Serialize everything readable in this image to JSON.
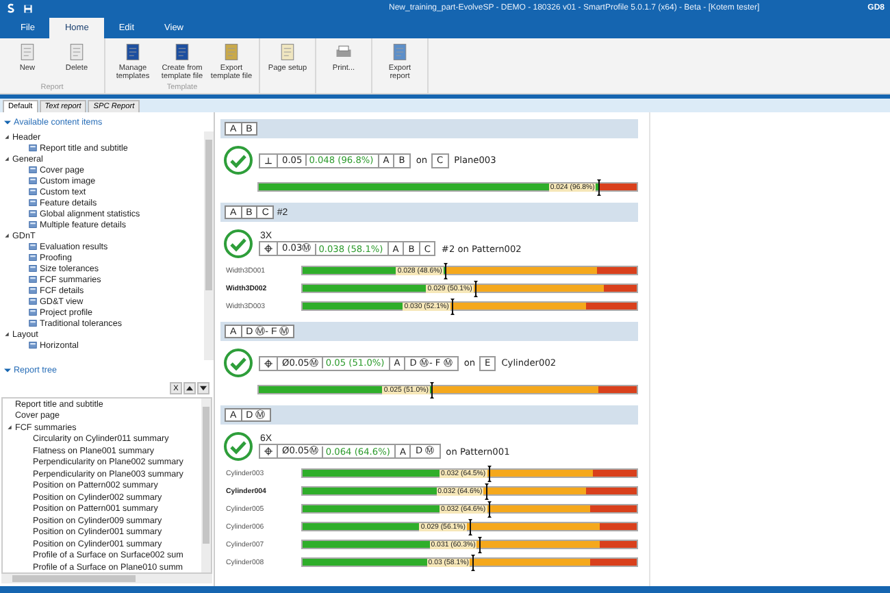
{
  "window": {
    "title": "New_training_part-EvolveSP - DEMO - 180326 v01 - SmartProfile 5.0.1.7 (x64) - Beta - [Kotem tester]",
    "title_right": "GD8"
  },
  "menu_tabs": [
    {
      "label": "File",
      "selected": false
    },
    {
      "label": "Home",
      "selected": true
    },
    {
      "label": "Edit",
      "selected": false
    },
    {
      "label": "View",
      "selected": false
    }
  ],
  "ribbon_groups": [
    {
      "label": "Report",
      "buttons": [
        {
          "kind": "new",
          "label": "New"
        },
        {
          "kind": "delete",
          "label": "Delete"
        }
      ]
    },
    {
      "label": "Template",
      "buttons": [
        {
          "kind": "manage",
          "label": "Manage templates"
        },
        {
          "kind": "create",
          "label": "Create from template file"
        },
        {
          "kind": "export-template",
          "label": "Export template file"
        }
      ]
    },
    {
      "buttons": [
        {
          "kind": "page",
          "label": "Page setup"
        }
      ]
    },
    {
      "buttons": [
        {
          "kind": "print",
          "label": "Print..."
        }
      ]
    },
    {
      "buttons": [
        {
          "kind": "export",
          "label": "Export report"
        }
      ]
    }
  ],
  "doc_tabs": [
    {
      "label": "Default",
      "selected": true
    },
    {
      "label": "Text report",
      "selected": false
    },
    {
      "label": "SPC Report",
      "selected": false
    }
  ],
  "content_panel": {
    "title": "Available content items",
    "expanded": true,
    "items": [
      {
        "label": "Header",
        "expanded": true,
        "children": [
          {
            "label": "Report title and subtitle"
          }
        ]
      },
      {
        "label": "General",
        "expanded": true,
        "children": [
          {
            "label": "Cover page"
          },
          {
            "label": "Custom image"
          },
          {
            "label": "Custom text"
          },
          {
            "label": "Feature details"
          },
          {
            "label": "Global alignment statistics"
          },
          {
            "label": "Multiple feature details"
          }
        ]
      },
      {
        "label": "GDnT",
        "expanded": true,
        "children": [
          {
            "label": "Evaluation results"
          },
          {
            "label": "Proofing"
          },
          {
            "label": "Size tolerances"
          },
          {
            "label": "FCF summaries"
          },
          {
            "label": "FCF details"
          },
          {
            "label": "GD&T view"
          },
          {
            "label": "Project profile"
          },
          {
            "label": "Traditional tolerances"
          }
        ]
      },
      {
        "label": "Layout",
        "expanded": true,
        "children": [
          {
            "label": "Horizontal"
          }
        ]
      }
    ]
  },
  "report_tree": {
    "title": "Report tree",
    "expanded": true,
    "remove_button": "X",
    "items": [
      {
        "label": "Report title and subtitle"
      },
      {
        "label": "Cover page"
      },
      {
        "label": "FCF summaries",
        "expanded": true,
        "children": [
          {
            "label": "Circularity on Cylinder011 summary"
          },
          {
            "label": "Flatness on Plane001 summary"
          },
          {
            "label": "Perpendicularity on Plane002 summary"
          },
          {
            "label": "Perpendicularity on Plane003 summary"
          },
          {
            "label": "Position on Pattern002 summary"
          },
          {
            "label": "Position on Cylinder002 summary"
          },
          {
            "label": "Position on Pattern001 summary"
          },
          {
            "label": "Position on Cylinder009 summary"
          },
          {
            "label": "Position on Cylinder001 summary"
          },
          {
            "label": "Position on Cylinder001 summary"
          },
          {
            "label": "Profile of a Surface on Surface002 sum"
          },
          {
            "label": "Profile of a Surface on Plane010 summ"
          }
        ]
      }
    ]
  },
  "sections": [
    {
      "header": {
        "cells": [
          "A",
          "B"
        ]
      },
      "passed": true,
      "fcf": {
        "kind": "perpendicularity",
        "tolerance": "0.05",
        "actual": "0.048 (96.8%)",
        "datums": [
          "A",
          "B"
        ]
      },
      "suffix": [
        {
          "kind": "text",
          "text": "on"
        },
        {
          "kind": "box",
          "text": "C"
        },
        {
          "kind": "text",
          "text": "Plane003"
        }
      ],
      "bars": [
        {
          "reading": "0.024 (96.8%)",
          "level": 0.9,
          "fills": [
            {
              "kind": "pass",
              "level": 0.9
            }
          ]
        }
      ]
    },
    {
      "header": {
        "cells": [
          "A",
          "B",
          "C"
        ],
        "note": "#2"
      },
      "passed": true,
      "count": "3X",
      "fcf": {
        "kind": "position",
        "tolerance": "0.03Ⓜ",
        "actual": "0.038 (58.1%)",
        "datums": [
          "A",
          "B",
          "C"
        ]
      },
      "suffix": [
        {
          "kind": "text",
          "text": "#2 on Pattern002"
        }
      ],
      "bars": [
        {
          "label": "Width3D001",
          "selected": false,
          "reading": "0.028 (48.6%)",
          "level": 0.43,
          "fills": [
            {
              "kind": "warn",
              "level": 0.88
            },
            {
              "kind": "pass",
              "level": 0.43
            }
          ]
        },
        {
          "label": "Width3D002",
          "selected": true,
          "reading": "0.029 (50.1%)",
          "level": 0.52,
          "fills": [
            {
              "kind": "warn",
              "level": 0.9
            },
            {
              "kind": "pass",
              "level": 0.42
            }
          ]
        },
        {
          "label": "Width3D003",
          "selected": false,
          "reading": "0.030 (52.1%)",
          "level": 0.45,
          "fills": [
            {
              "kind": "warn",
              "level": 0.85
            },
            {
              "kind": "pass",
              "level": 0.43
            }
          ]
        }
      ]
    },
    {
      "header": {
        "cells": [
          "A",
          "D Ⓜ- F Ⓜ"
        ]
      },
      "passed": true,
      "fcf": {
        "kind": "position",
        "tolerance": "Ø0.05Ⓜ",
        "actual": "0.05 (51.0%)",
        "datums": [
          "A",
          "D Ⓜ- F Ⓜ"
        ]
      },
      "suffix": [
        {
          "kind": "text",
          "text": "on"
        },
        {
          "kind": "box",
          "text": "E"
        },
        {
          "kind": "text",
          "text": "Cylinder002"
        }
      ],
      "bars": [
        {
          "reading": "0.025 (51.0%)",
          "level": 0.46,
          "fills": [
            {
              "kind": "warn",
              "level": 0.9
            },
            {
              "kind": "pass",
              "level": 0.46
            }
          ]
        }
      ]
    },
    {
      "header": {
        "cells": [
          "A",
          "D Ⓜ"
        ]
      },
      "passed": true,
      "count": "6X",
      "fcf": {
        "kind": "position",
        "tolerance": "Ø0.05Ⓜ",
        "actual": "0.064 (64.6%)",
        "datums": [
          "A",
          "D Ⓜ"
        ]
      },
      "suffix": [
        {
          "kind": "text",
          "text": "on Pattern001"
        }
      ],
      "bars": [
        {
          "label": "Cylinder003",
          "selected": false,
          "reading": "0.032 (64.5%)",
          "level": 0.56,
          "fills": [
            {
              "kind": "warn",
              "level": 0.87
            },
            {
              "kind": "pass",
              "level": 0.43
            }
          ]
        },
        {
          "label": "Cylinder004",
          "selected": true,
          "reading": "0.032 (64.6%)",
          "level": 0.55,
          "fills": [
            {
              "kind": "warn",
              "level": 0.85
            },
            {
              "kind": "pass",
              "level": 0.43
            }
          ]
        },
        {
          "label": "Cylinder005",
          "selected": false,
          "reading": "0.032 (64.6%)",
          "level": 0.56,
          "fills": [
            {
              "kind": "warn",
              "level": 0.86
            },
            {
              "kind": "pass",
              "level": 0.43
            }
          ]
        },
        {
          "label": "Cylinder006",
          "selected": false,
          "reading": "0.029 (56.1%)",
          "level": 0.5,
          "fills": [
            {
              "kind": "warn",
              "level": 0.89
            },
            {
              "kind": "pass",
              "level": 0.43
            }
          ]
        },
        {
          "label": "Cylinder007",
          "selected": false,
          "reading": "0.031 (60.3%)",
          "level": 0.53,
          "fills": [
            {
              "kind": "warn",
              "level": 0.89
            },
            {
              "kind": "pass",
              "level": 0.43
            }
          ]
        },
        {
          "label": "Cylinder008",
          "selected": false,
          "reading": "0.03 (58.1%)",
          "level": 0.51,
          "fills": [
            {
              "kind": "warn",
              "level": 0.86
            },
            {
              "kind": "pass",
              "level": 0.43
            }
          ]
        }
      ]
    }
  ]
}
